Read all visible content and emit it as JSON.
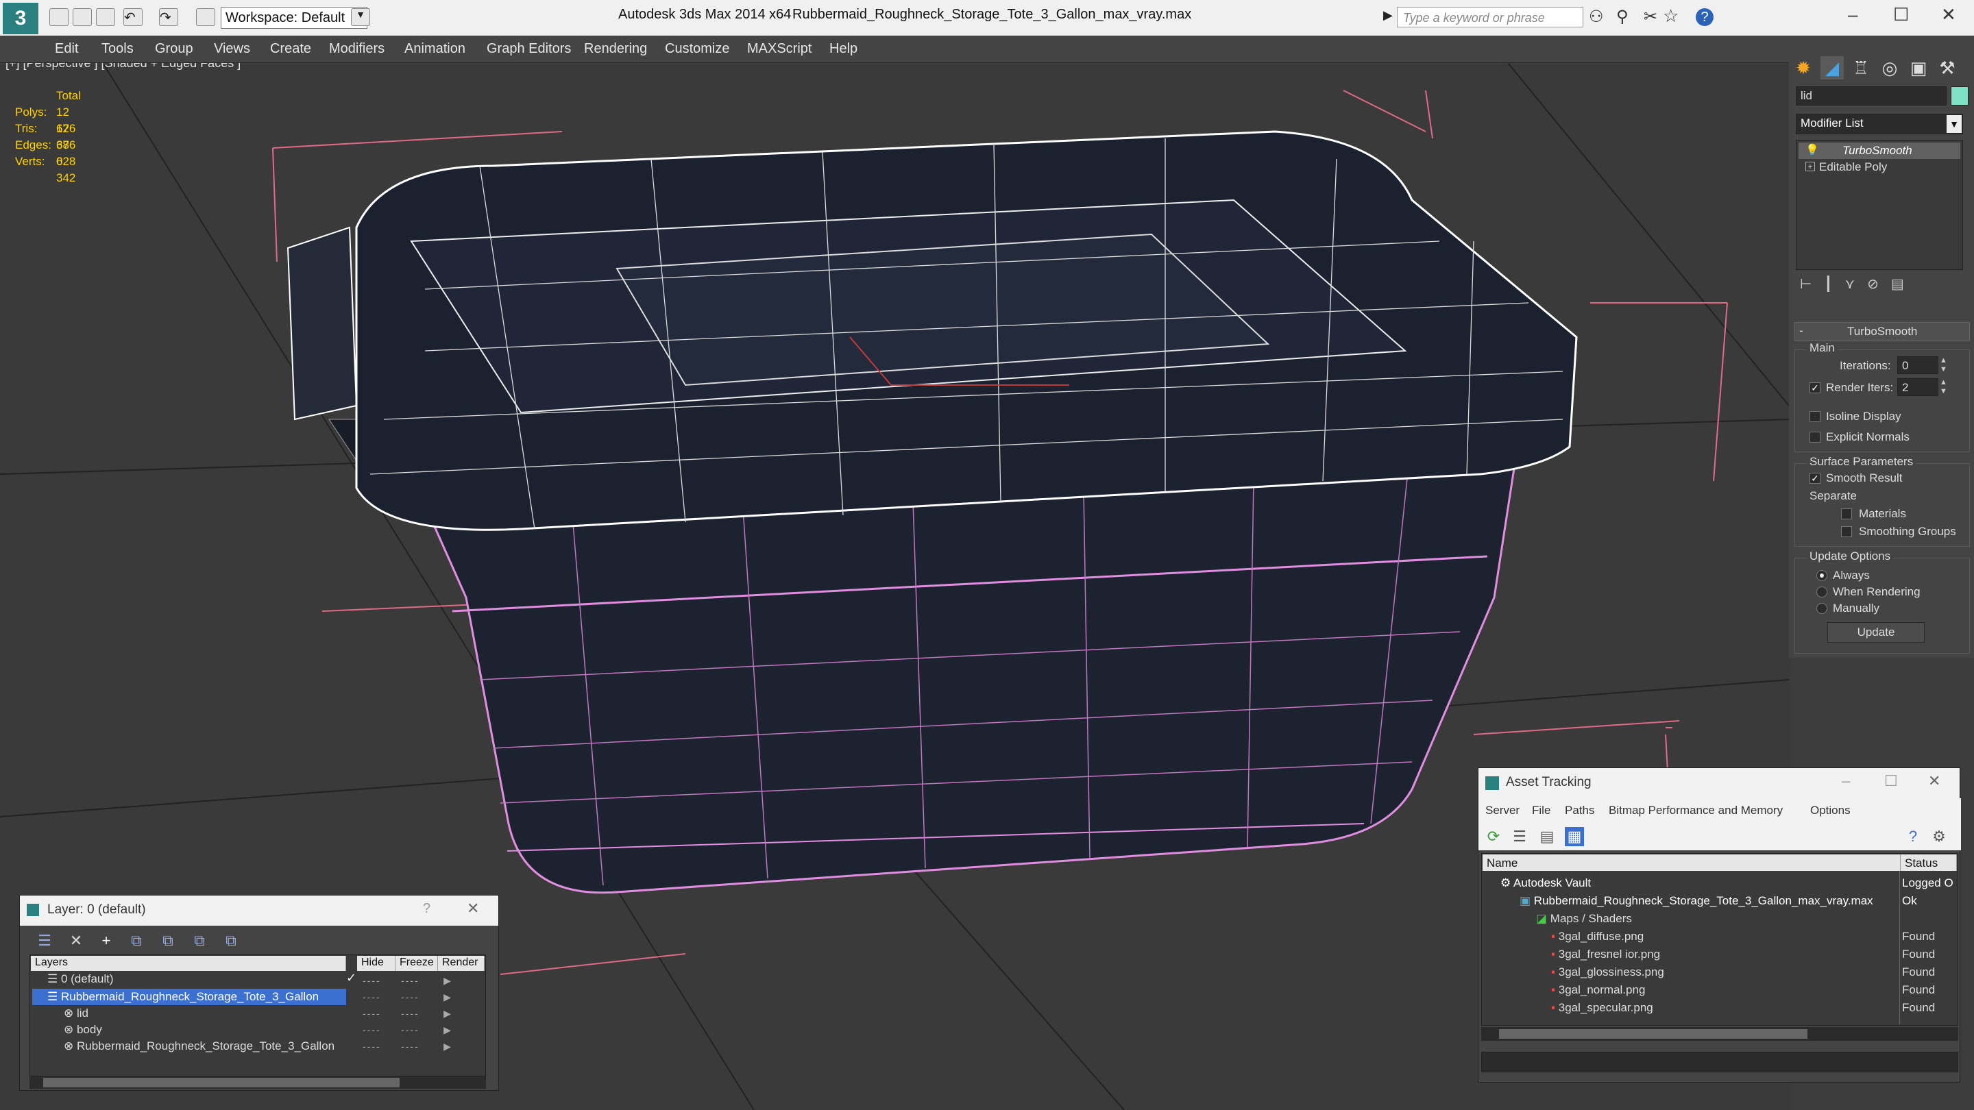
{
  "app": {
    "title": "Autodesk 3ds Max  2014 x64",
    "file": "Rubbermaid_Roughneck_Storage_Tote_3_Gallon_max_vray.max",
    "workspace": "Workspace: Default",
    "search_placeholder": "Type a keyword or phrase"
  },
  "menu": [
    "Edit",
    "Tools",
    "Group",
    "Views",
    "Create",
    "Modifiers",
    "Animation",
    "Graph Editors",
    "Rendering",
    "Customize",
    "MAXScript",
    "Help"
  ],
  "viewport": {
    "label": "[+] [Perspective ] [Shaded + Edged Faces ]",
    "stats": {
      "header": "Total",
      "rows": [
        {
          "k": "Polys:",
          "v": "12 676"
        },
        {
          "k": "Tris:",
          "v": "12 676"
        },
        {
          "k": "Edges:",
          "v": "38 028"
        },
        {
          "k": "Verts:",
          "v": "6 342"
        }
      ]
    }
  },
  "command_panel": {
    "object_name": "lid",
    "modifier_list": "Modifier List",
    "stack": [
      "TurboSmooth",
      "Editable Poly"
    ],
    "rollout_title": "TurboSmooth",
    "main_group": "Main",
    "iterations_label": "Iterations:",
    "iterations_value": "0",
    "render_iters_label": "Render Iters:",
    "render_iters_value": "2",
    "isoline": "Isoline Display",
    "explicit_normals": "Explicit Normals",
    "surface_group": "Surface Parameters",
    "smooth_result": "Smooth Result",
    "separate": "Separate",
    "materials": "Materials",
    "smoothing_groups": "Smoothing Groups",
    "update_group": "Update Options",
    "always": "Always",
    "when_rendering": "When Rendering",
    "manually": "Manually",
    "update_button": "Update"
  },
  "layer_window": {
    "title": "Layer: 0 (default)",
    "columns": [
      "Layers",
      "Hide",
      "Freeze",
      "Render"
    ],
    "rows": [
      {
        "name": "0 (default)",
        "indent": 0
      },
      {
        "name": "Rubbermaid_Roughneck_Storage_Tote_3_Gallon",
        "indent": 0,
        "selected": true
      },
      {
        "name": "lid",
        "indent": 1
      },
      {
        "name": "body",
        "indent": 1
      },
      {
        "name": "Rubbermaid_Roughneck_Storage_Tote_3_Gallon",
        "indent": 1
      }
    ]
  },
  "asset_window": {
    "title": "Asset Tracking",
    "menu": [
      "Server",
      "File",
      "Paths",
      "Bitmap Performance and Memory",
      "Options"
    ],
    "columns": [
      "Name",
      "Status"
    ],
    "rows": [
      {
        "name": "Autodesk Vault",
        "status": "Logged O",
        "indent": 0
      },
      {
        "name": "Rubbermaid_Roughneck_Storage_Tote_3_Gallon_max_vray.max",
        "status": "Ok",
        "indent": 1
      },
      {
        "name": "Maps / Shaders",
        "status": "",
        "indent": 2
      },
      {
        "name": "3gal_diffuse.png",
        "status": "Found",
        "indent": 3
      },
      {
        "name": "3gal_fresnel ior.png",
        "status": "Found",
        "indent": 3
      },
      {
        "name": "3gal_glossiness.png",
        "status": "Found",
        "indent": 3
      },
      {
        "name": "3gal_normal.png",
        "status": "Found",
        "indent": 3
      },
      {
        "name": "3gal_specular.png",
        "status": "Found",
        "indent": 3
      }
    ]
  },
  "colors": {
    "accent": "#1a73e8",
    "selection": "#3b6fd0",
    "stats": "#ffd200",
    "wire_pink": "#d77fd0"
  }
}
